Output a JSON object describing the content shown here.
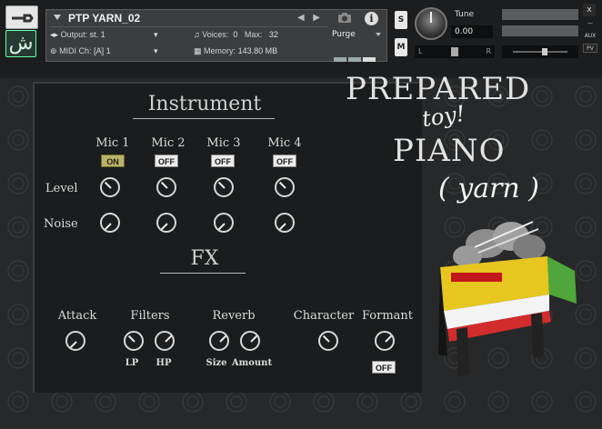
{
  "header": {
    "instrument_name": "PTP YARN_02",
    "output_label": "Output:",
    "output_value": "st. 1",
    "voices_label": "Voices:",
    "voices_value": "0",
    "max_label": "Max:",
    "max_value": "32",
    "midi_label": "MIDI Ch:",
    "midi_value": "[A]  1",
    "memory_label": "Memory:",
    "memory_value": "143.80 MB",
    "purge_label": "Purge",
    "solo_label": "S",
    "mute_label": "M",
    "tune_label": "Tune",
    "tune_value": "0.00",
    "pan_left": "L",
    "pan_right": "R",
    "close_label": "x",
    "aux_label": "AUX",
    "pv_label": "PV",
    "logo_glyph": "ش"
  },
  "instrument_panel": {
    "title": "Instrument",
    "mics": [
      {
        "label": "Mic 1",
        "state": "ON"
      },
      {
        "label": "Mic 2",
        "state": "OFF"
      },
      {
        "label": "Mic 3",
        "state": "OFF"
      },
      {
        "label": "Mic 4",
        "state": "OFF"
      }
    ],
    "row_level": "Level",
    "row_noise": "Noise"
  },
  "fx_panel": {
    "title": "FX",
    "attack": "Attack",
    "filters": "Filters",
    "filter_lp": "LP",
    "filter_hp": "HP",
    "reverb": "Reverb",
    "reverb_size": "Size",
    "reverb_amount": "Amount",
    "character": "Character",
    "formant": "Formant",
    "formant_state": "OFF"
  },
  "branding": {
    "line1": "PREPARED",
    "line2": "toy!",
    "line3": "PIANO",
    "line4": "( yarn )"
  },
  "colors": {
    "toggle_on": "#b9b46a",
    "toggle_off": "#ececec",
    "panel_bg": "#1a1c1d"
  }
}
